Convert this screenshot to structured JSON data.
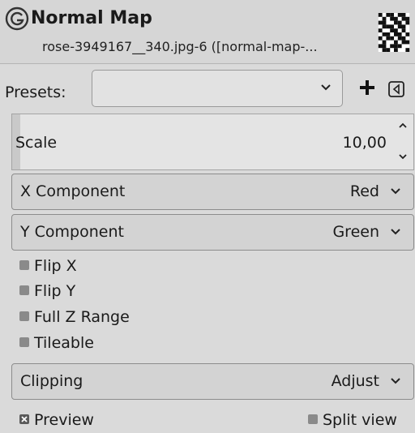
{
  "header": {
    "title": "Normal Map",
    "subtitle": "rose-3949167__340.jpg-6 ([normal-map-..."
  },
  "presets": {
    "label": "Presets:",
    "value": ""
  },
  "scale": {
    "label": "Scale",
    "value": "10,00",
    "fill_fraction": 0.02
  },
  "x_component": {
    "label": "X Component",
    "value": "Red"
  },
  "y_component": {
    "label": "Y Component",
    "value": "Green"
  },
  "options": [
    {
      "label": "Flip X",
      "checked": false
    },
    {
      "label": "Flip Y",
      "checked": false
    },
    {
      "label": "Full Z Range",
      "checked": false
    },
    {
      "label": "Tileable",
      "checked": false
    }
  ],
  "clipping": {
    "label": "Clipping",
    "value": "Adjust"
  },
  "footer": {
    "preview_label": "Preview",
    "preview_checked": true,
    "split_view_label": "Split view",
    "split_view_checked": false
  },
  "icons": {
    "app": "gimp-g-icon",
    "add": "plus-icon",
    "menu": "menu-triangle-icon",
    "dropdown": "chevron-down-icon",
    "spin_up": "chevron-up-icon",
    "spin_down": "chevron-down-icon"
  }
}
